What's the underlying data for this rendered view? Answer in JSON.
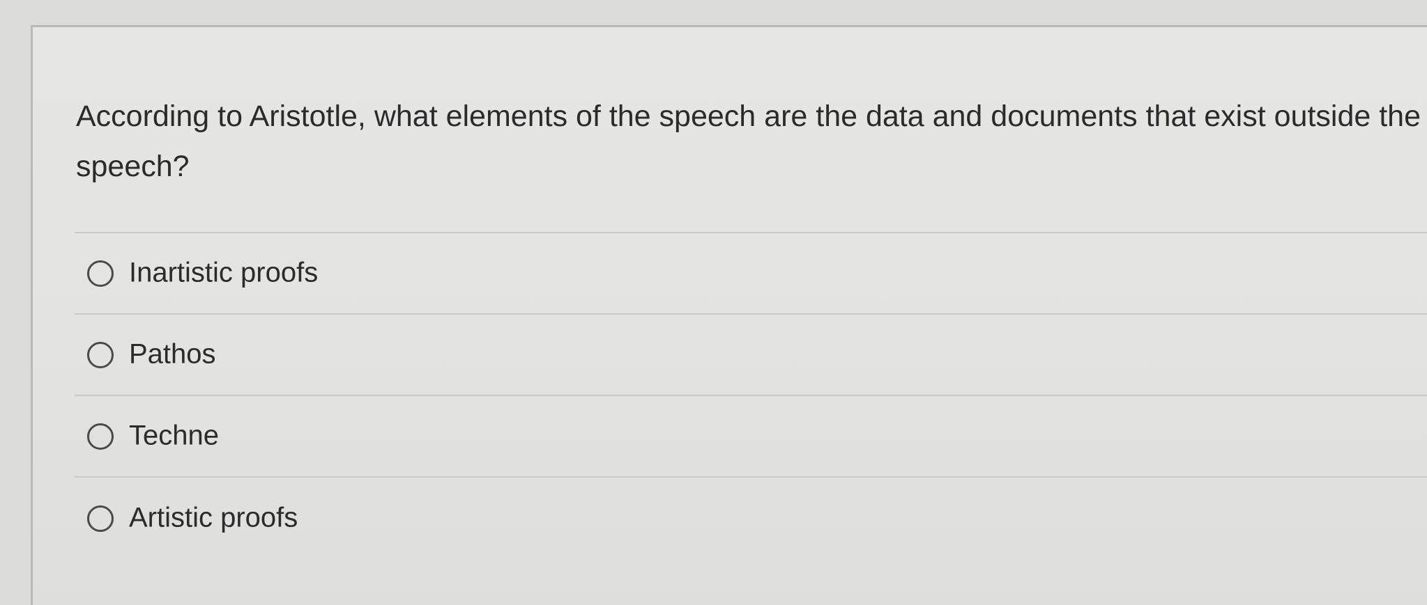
{
  "quiz": {
    "question": "According to Aristotle, what elements of the speech are the data and documents that exist outside the speech?",
    "options": [
      {
        "label": "Inartistic proofs",
        "selected": false
      },
      {
        "label": "Pathos",
        "selected": false
      },
      {
        "label": "Techne",
        "selected": false
      },
      {
        "label": "Artistic proofs",
        "selected": false
      }
    ]
  },
  "colors": {
    "page_background": "#dcdcda",
    "panel_background": "#e4e4e2",
    "text": "#2b2b2b",
    "divider": "#c9c9c6",
    "radio_border": "#4a4a4a"
  }
}
